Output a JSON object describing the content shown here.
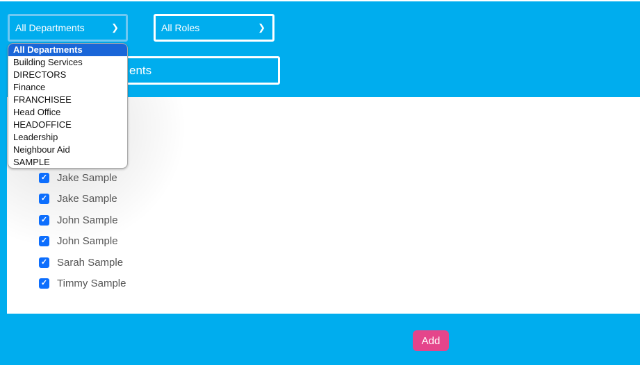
{
  "filters": {
    "department": {
      "value": "All Departments",
      "options": [
        "All Departments",
        "Building Services",
        "DIRECTORS",
        "Finance",
        "FRANCHISEE",
        "Head Office",
        "HEADOFFICE",
        "Leadership",
        "Neighbour Aid",
        "SAMPLE"
      ]
    },
    "role": {
      "value": "All Roles"
    }
  },
  "search": {
    "visible_text": "ents"
  },
  "people": [
    "Jake Sample",
    "Jake Sample",
    "John Sample",
    "John Sample",
    "Sarah Sample",
    "Timmy Sample"
  ],
  "add_label": "Add",
  "colors": {
    "background": "#00adee",
    "accent": "#e5458b",
    "checkbox": "#0d6efd",
    "highlight": "#1a66d8"
  }
}
